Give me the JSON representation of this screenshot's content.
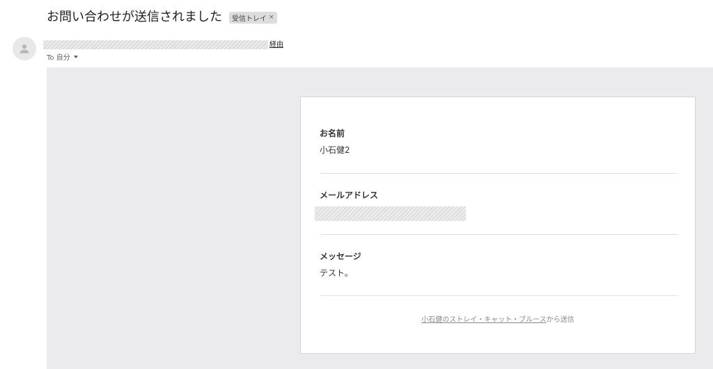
{
  "header": {
    "subject": "お問い合わせが送信されました",
    "label_chip": "受信トレイ",
    "label_chip_close": "×"
  },
  "sender": {
    "via_label": "経由",
    "to_label": "To 自分"
  },
  "form": {
    "name_label": "お名前",
    "name_value": "小石健2",
    "email_label": "メールアドレス",
    "message_label": "メッセージ",
    "message_value": "テスト。",
    "footer_link": "小石健のストレイ・キャット・ブルース",
    "footer_suffix": "から送信"
  },
  "colors": {
    "body_background": "#ebebed",
    "card_background": "#ffffff",
    "chip_background": "#dddddd"
  }
}
